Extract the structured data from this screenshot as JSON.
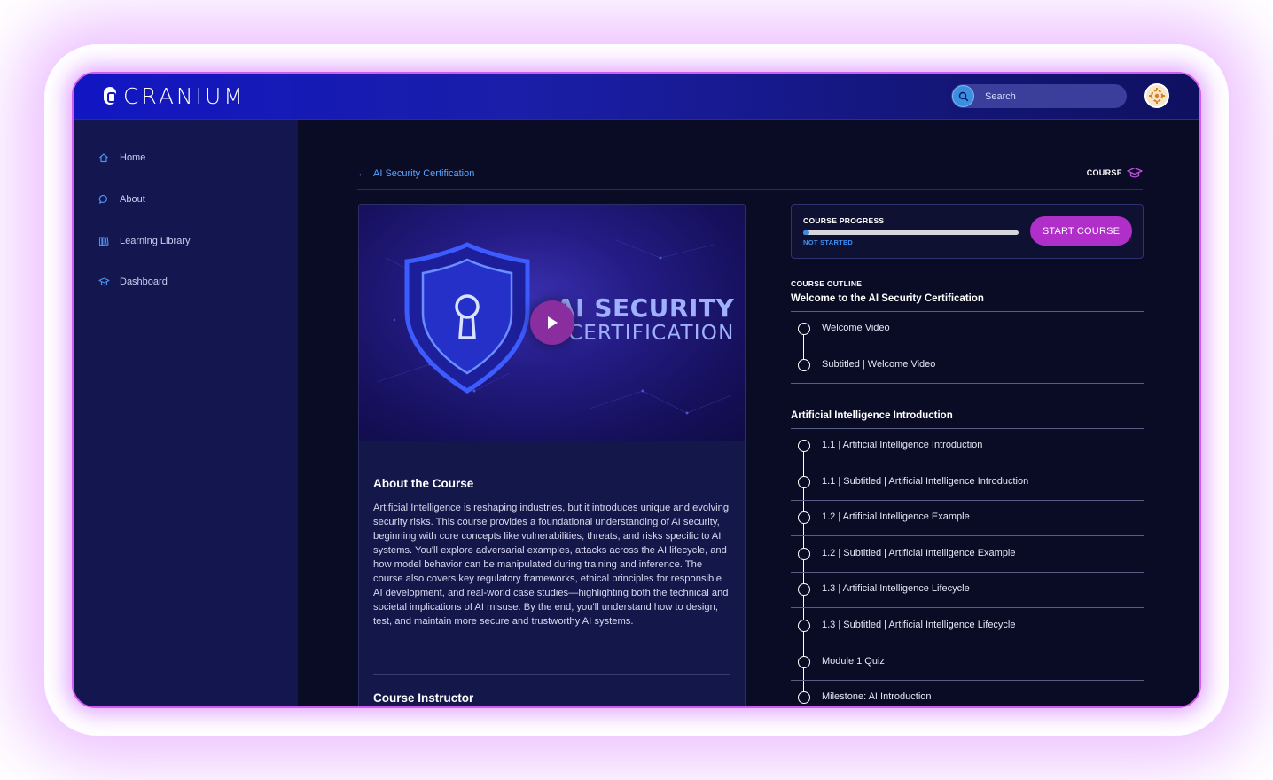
{
  "header": {
    "brand": "CRANIUM",
    "search_placeholder": "Search"
  },
  "sidebar": {
    "items": [
      {
        "label": "Home",
        "icon": "home-icon"
      },
      {
        "label": "About",
        "icon": "chat-icon"
      },
      {
        "label": "Learning Library",
        "icon": "library-icon"
      },
      {
        "label": "Dashboard",
        "icon": "mortarboard-icon"
      }
    ]
  },
  "breadcrumb": {
    "label": "AI Security Certification",
    "tag": "COURSE"
  },
  "video": {
    "title_line1": "AI SECURITY",
    "title_line2": "CERTIFICATION"
  },
  "about": {
    "heading": "About the Course",
    "body": "Artificial Intelligence is reshaping industries, but it introduces unique and evolving security risks. This course provides a foundational understanding of AI security, beginning with core concepts like vulnerabilities, threats, and risks specific to AI systems. You'll explore adversarial examples, attacks across the AI lifecycle, and how model behavior can be manipulated during training and inference. The course also covers key regulatory frameworks, ethical principles for responsible AI development, and real-world case studies—highlighting both the technical and societal implications of AI misuse. By the end, you'll understand how to design, test, and maintain more secure and trustworthy AI systems.",
    "instructor_heading": "Course Instructor"
  },
  "progress": {
    "label": "COURSE PROGRESS",
    "status": "NOT STARTED",
    "value": 0.03,
    "button_label": "START COURSE"
  },
  "outline": {
    "label": "COURSE OUTLINE",
    "sections": [
      {
        "title": "Welcome to the AI Security Certification",
        "items": [
          "Welcome Video",
          "Subtitled | Welcome Video"
        ]
      },
      {
        "title": "Artificial Intelligence Introduction",
        "items": [
          "1.1 | Artificial Intelligence Introduction",
          "1.1 | Subtitled | Artificial Intelligence Introduction",
          "1.2 | Artificial Intelligence Example",
          "1.2 | Subtitled | Artificial Intelligence Example",
          "1.3 | Artificial Intelligence Lifecycle",
          "1.3 | Subtitled | Artificial Intelligence Lifecycle",
          "Module 1 Quiz",
          "Milestone: AI Introduction"
        ]
      }
    ]
  },
  "colors": {
    "accent": "#b02fc9",
    "link": "#5aa6ff",
    "frame_border": "#d15cf2",
    "header_blue": "#1216c2"
  }
}
